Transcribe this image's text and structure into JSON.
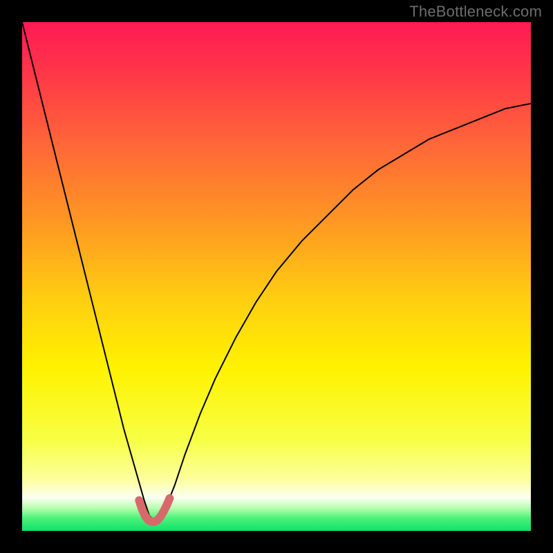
{
  "attribution": "TheBottleneck.com",
  "chart_data": {
    "type": "line",
    "title": "",
    "xlabel": "",
    "ylabel": "",
    "xlim": [
      0,
      100
    ],
    "ylim": [
      0,
      100
    ],
    "grid": false,
    "legend": false,
    "background_gradient": {
      "stops": [
        {
          "offset": 0.0,
          "color": "#ff1a54"
        },
        {
          "offset": 0.1,
          "color": "#ff3648"
        },
        {
          "offset": 0.25,
          "color": "#ff6a37"
        },
        {
          "offset": 0.4,
          "color": "#ff9a22"
        },
        {
          "offset": 0.55,
          "color": "#ffd010"
        },
        {
          "offset": 0.68,
          "color": "#fff200"
        },
        {
          "offset": 0.82,
          "color": "#f7ff44"
        },
        {
          "offset": 0.9,
          "color": "#fdffa0"
        },
        {
          "offset": 0.935,
          "color": "#fafff2"
        },
        {
          "offset": 0.955,
          "color": "#b8ffb0"
        },
        {
          "offset": 0.975,
          "color": "#4cf27a"
        },
        {
          "offset": 1.0,
          "color": "#0fe26a"
        }
      ]
    },
    "series": [
      {
        "name": "bottleneck-curve",
        "color": "#000000",
        "stroke_width": 2,
        "x": [
          0,
          2,
          4,
          6,
          8,
          10,
          12,
          14,
          16,
          18,
          20,
          22,
          24,
          25,
          26,
          27,
          28,
          30,
          32,
          35,
          38,
          42,
          46,
          50,
          55,
          60,
          65,
          70,
          75,
          80,
          85,
          90,
          95,
          100
        ],
        "y": [
          100,
          92,
          84,
          76,
          68,
          60,
          52,
          44,
          36,
          28,
          20,
          13,
          6,
          3,
          2,
          2,
          4,
          9,
          15,
          23,
          30,
          38,
          45,
          51,
          57,
          62,
          67,
          71,
          74,
          77,
          79,
          81,
          83,
          84
        ]
      },
      {
        "name": "optimal-highlight",
        "color": "#d66a6a",
        "stroke_width": 12,
        "x": [
          23.0,
          23.6,
          24.2,
          24.8,
          25.4,
          26.0,
          26.6,
          27.2,
          27.8,
          28.4,
          29.0
        ],
        "y": [
          6.0,
          4.2,
          2.9,
          2.1,
          1.8,
          1.8,
          2.1,
          2.8,
          3.8,
          5.0,
          6.4
        ]
      }
    ]
  }
}
